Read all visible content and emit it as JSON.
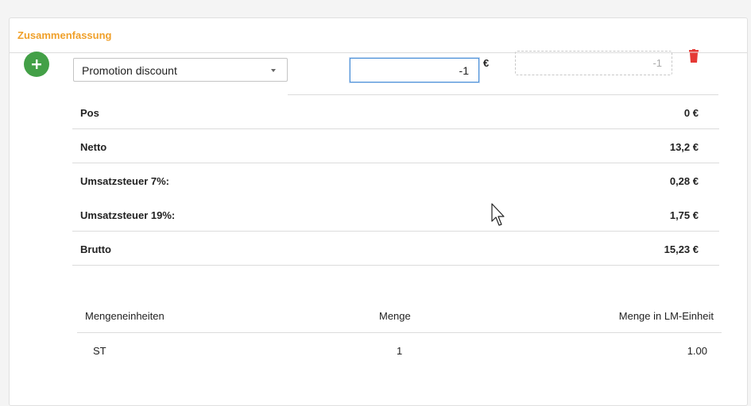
{
  "panel": {
    "title": "Zusammenfassung"
  },
  "discount": {
    "type_value": "Promotion discount",
    "amount_value": "-1",
    "currency": "€",
    "computed_value": "-1"
  },
  "totals": [
    {
      "label": "Pos",
      "value": "0 €"
    },
    {
      "label": "Netto",
      "value": "13,2 €"
    },
    {
      "label": "Umsatzsteuer 7%:",
      "value": "0,28 €"
    },
    {
      "label": "Umsatzsteuer 19%:",
      "value": "1,75 €"
    },
    {
      "label": "Brutto",
      "value": "15,23 €"
    }
  ],
  "units_table": {
    "headers": [
      "Mengeneinheiten",
      "Menge",
      "Menge in LM-Einheit"
    ],
    "rows": [
      [
        "ST",
        "1",
        "1.00"
      ]
    ]
  },
  "colors": {
    "title": "#f0a02a",
    "add_button": "#43a047",
    "delete_icon": "#e53935",
    "focus_border": "#4a8fd8"
  },
  "icons": {
    "add": "plus-icon",
    "delete": "trash-icon",
    "dropdown": "caret-down-icon"
  }
}
